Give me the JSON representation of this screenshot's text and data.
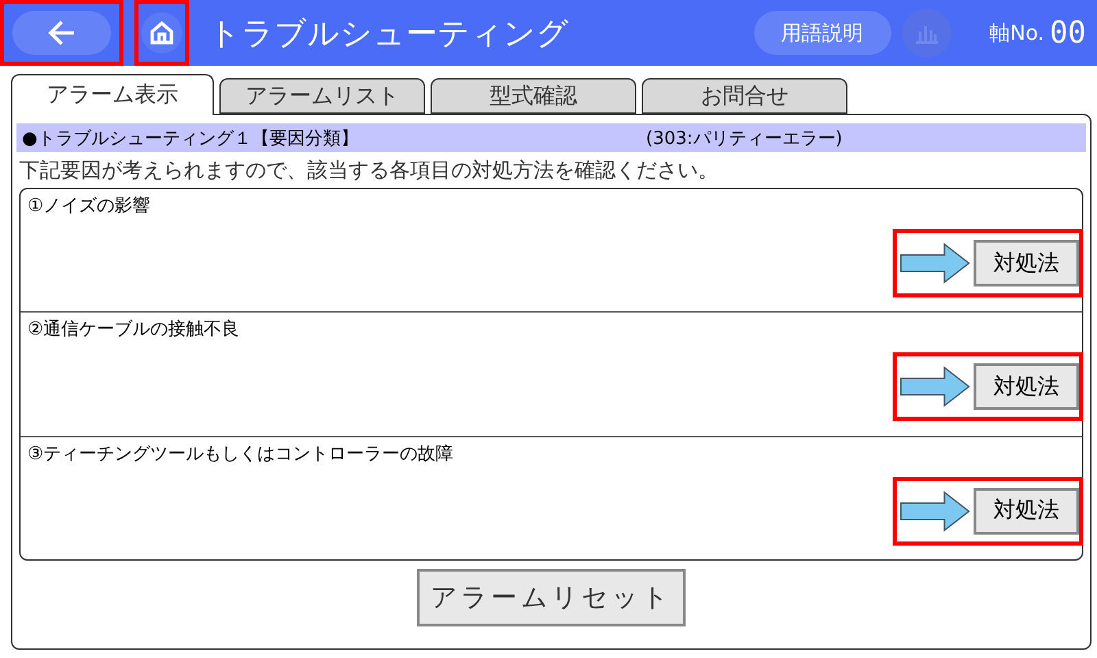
{
  "header": {
    "title": "トラブルシューティング",
    "glossary_button": "用語説明",
    "chart_button_disabled": true,
    "axis_label": "軸No.",
    "axis_number": "00"
  },
  "tabs": [
    {
      "label": "アラーム表示",
      "selected": true
    },
    {
      "label": "アラームリスト",
      "selected": false
    },
    {
      "label": "型式確認",
      "selected": false
    },
    {
      "label": "お問合せ",
      "selected": false
    }
  ],
  "heading": {
    "title": "●トラブルシューティング１【要因分類】",
    "alarm": "(303:パリティーエラー)"
  },
  "instruction": "下記要因が考えられますので、該当する各項目の対処方法を確認ください。",
  "causes": [
    {
      "label": "①ノイズの影響",
      "button": "対処法"
    },
    {
      "label": "②通信ケーブルの接触不良",
      "button": "対処法"
    },
    {
      "label": "③ティーチングツールもしくはコントローラーの故障",
      "button": "対処法"
    }
  ],
  "reset_button": "アラームリセット"
}
